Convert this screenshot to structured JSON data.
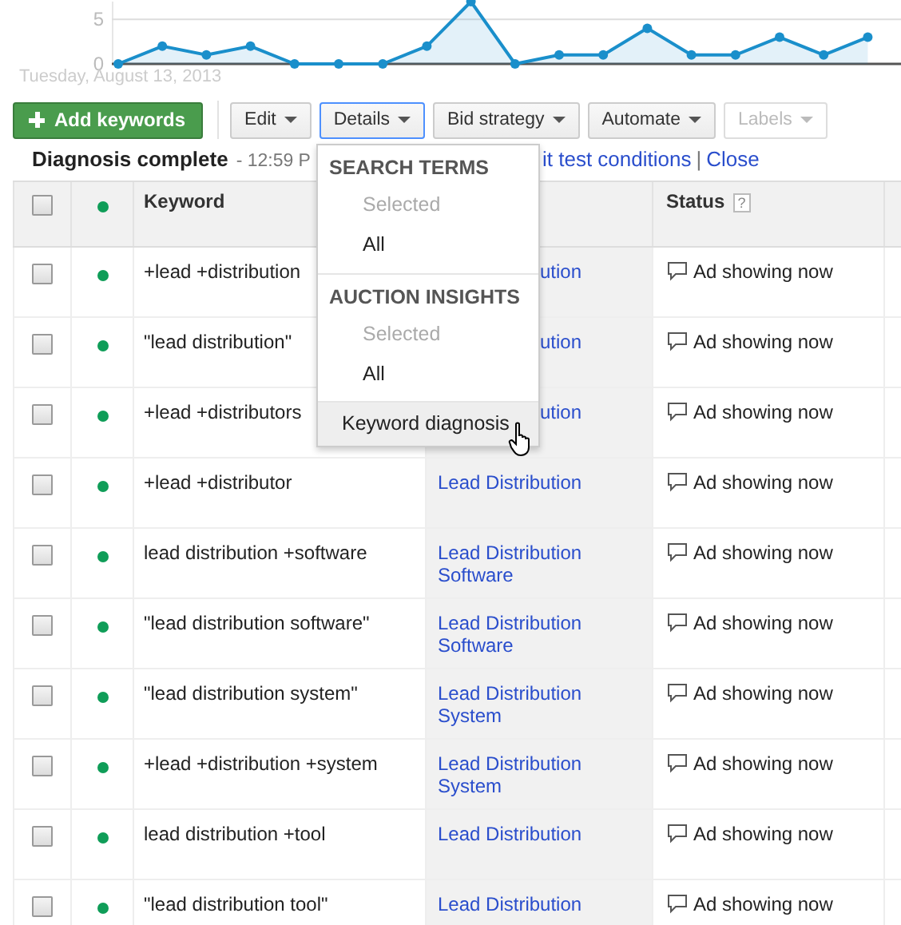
{
  "chart": {
    "chart_data": {
      "type": "area",
      "yticks": [
        0,
        5
      ],
      "ylim": [
        0,
        7
      ],
      "series": [
        {
          "color": "#1a8fcb",
          "values": [
            0,
            2,
            1,
            2,
            0,
            0,
            0,
            2,
            7,
            0,
            1,
            1,
            4,
            1,
            1,
            3,
            1,
            3
          ]
        }
      ]
    },
    "date_label": "Tuesday, August 13, 2013"
  },
  "toolbar": {
    "add_button": "Add keywords",
    "buttons": [
      {
        "label": "Edit",
        "selected": false,
        "disabled": false
      },
      {
        "label": "Details",
        "selected": true,
        "disabled": false
      },
      {
        "label": "Bid strategy",
        "selected": false,
        "disabled": false
      },
      {
        "label": "Automate",
        "selected": false,
        "disabled": false
      },
      {
        "label": "Labels",
        "selected": false,
        "disabled": true
      }
    ]
  },
  "diagnosis_bar": {
    "title": "Diagnosis complete",
    "time": "- 12:59 P",
    "edit_link": "it test conditions",
    "separator": "|",
    "close_link": "Close"
  },
  "details_menu": [
    {
      "kind": "heading",
      "label": "SEARCH TERMS"
    },
    {
      "kind": "item",
      "label": "Selected",
      "disabled": true,
      "hovered": false
    },
    {
      "kind": "item",
      "label": "All",
      "disabled": false,
      "hovered": false
    },
    {
      "kind": "heading",
      "label": "AUCTION INSIGHTS"
    },
    {
      "kind": "item",
      "label": "Selected",
      "disabled": true,
      "hovered": false
    },
    {
      "kind": "item",
      "label": "All",
      "disabled": false,
      "hovered": false
    },
    {
      "kind": "divider"
    },
    {
      "kind": "item",
      "label": "Keyword diagnosis",
      "disabled": false,
      "hovered": true
    }
  ],
  "table": {
    "columns": [
      {
        "kind": "checkbox",
        "checked": false
      },
      {
        "kind": "dot",
        "color": "#0f9d58"
      },
      {
        "kind": "text",
        "label": "Keyword"
      },
      {
        "kind": "blank"
      },
      {
        "kind": "help",
        "label": "Status",
        "help": "?"
      },
      {
        "kind": "blank"
      }
    ],
    "rows": [
      {
        "checked": false,
        "color": "#0f9d58",
        "keyword": "+lead +distribution",
        "ad_group": "ution",
        "status": "Ad showing now"
      },
      {
        "checked": false,
        "color": "#0f9d58",
        "keyword": "\"lead distribution\"",
        "ad_group": "ution",
        "status": "Ad showing now"
      },
      {
        "checked": false,
        "color": "#0f9d58",
        "keyword": "+lead +distributors",
        "ad_group": "ution",
        "status": "Ad showing now"
      },
      {
        "checked": false,
        "color": "#0f9d58",
        "keyword": "+lead +distributor",
        "ad_group": "Lead Distribution",
        "status": "Ad showing now"
      },
      {
        "checked": false,
        "color": "#0f9d58",
        "keyword": "lead distribution +software",
        "ad_group": "Lead Distribution Software",
        "status": "Ad showing now"
      },
      {
        "checked": false,
        "color": "#0f9d58",
        "keyword": "\"lead distribution software\"",
        "ad_group": "Lead Distribution Software",
        "status": "Ad showing now"
      },
      {
        "checked": false,
        "color": "#0f9d58",
        "keyword": "\"lead distribution system\"",
        "ad_group": "Lead Distribution System",
        "status": "Ad showing now"
      },
      {
        "checked": false,
        "color": "#0f9d58",
        "keyword": "+lead +distribution +system",
        "ad_group": "Lead Distribution System",
        "status": "Ad showing now"
      },
      {
        "checked": false,
        "color": "#0f9d58",
        "keyword": "lead distribution +tool",
        "ad_group": "Lead Distribution",
        "status": "Ad showing now"
      },
      {
        "checked": false,
        "color": "#0f9d58",
        "keyword": "\"lead distribution tool\"",
        "ad_group": "Lead Distribution",
        "status": "Ad showing now"
      }
    ]
  }
}
